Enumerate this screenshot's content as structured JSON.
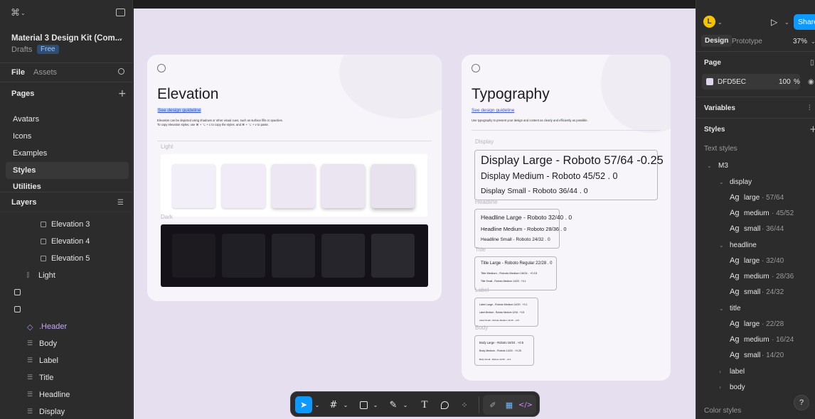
{
  "left_panel": {
    "file_title": "Material 3 Design Kit (Com...",
    "drafts": "Drafts",
    "plan_badge": "Free",
    "tab_file": "File",
    "tab_assets": "Assets",
    "pages_header": "Pages",
    "pages": [
      "Avatars",
      "Icons",
      "Examples",
      "Styles",
      "Utilities"
    ],
    "layers_header": "Layers",
    "layers": {
      "elevation3": "Elevation 3",
      "elevation4": "Elevation 4",
      "elevation5": "Elevation 5",
      "light": "Light",
      "header": ".Header",
      "body": "Body",
      "label": "Label",
      "title": "Title",
      "headline": "Headline",
      "display": "Display"
    }
  },
  "elevation_frame": {
    "title": "Elevation",
    "link": "See design guideline",
    "desc_line1": "Elevation can be depicted using shadows or other visual cues, such as surface fills or opacities.",
    "desc_line2": "To copy elevation styles, use ⌘ + ⌥ + c to copy the styles. and ⌘ + ⌥ + v to paste.",
    "light_label": "Light",
    "dark_label": "Dark"
  },
  "typography_frame": {
    "title": "Typography",
    "link": "See design guideline",
    "desc": "Use typography to present your design and content as clearly and efficiently as possible.",
    "display_label": "Display",
    "display_large": "Display Large - Roboto 57/64 -0.25",
    "display_medium": "Display Medium - Roboto 45/52 .  0",
    "display_small": "Display Small - Roboto 36/44 . 0",
    "headline_label": "Headline",
    "headline_large": "Headline Large - Roboto 32/40 . 0",
    "headline_medium": "Headline Medium - Roboto 28/36 . 0",
    "headline_small": "Headline Small - Roboto 24/32 . 0",
    "title_label": "Title",
    "title_large": "Title Large - Roboto Regular 22/28 . 0",
    "title_medium": "Title Medium - Roboto Medium 16/24 . +0.15",
    "title_small": "Title Small - Roboto Medium 14/20 . +0.1",
    "label_label": "Label",
    "label_large": "Label Large - Roboto Medium 14/20 . +0.1",
    "label_medium": "Label Medium - Roboto Medium 12/16 . +0.5",
    "label_small": "Label Small - Roboto Medium 11/16 . +0.5",
    "body_label": "Body",
    "body_large": "Body Large - Roboto 16/24 . +0.5",
    "body_medium": "Body Medium - Roboto 14/20 . +0.25",
    "body_small": "Body Small - Roboto 12/16 . +0.4"
  },
  "right_panel": {
    "avatar_letter": "L",
    "share": "Share",
    "tab_design": "Design",
    "tab_prototype": "Prototype",
    "zoom": "37%",
    "page_header": "Page",
    "page_color": "DFD5EC",
    "page_opacity": "100",
    "percent": "%",
    "variables": "Variables",
    "styles": "Styles",
    "text_styles": "Text styles",
    "group_m3": "M3",
    "display_group": "display",
    "headline_group": "headline",
    "title_group": "title",
    "label_group": "label",
    "body_group": "body",
    "ag": "Ag",
    "display_items": [
      {
        "name": "large",
        "spec": "· 57/64"
      },
      {
        "name": "medium",
        "spec": "· 45/52"
      },
      {
        "name": "small",
        "spec": "· 36/44"
      }
    ],
    "headline_items": [
      {
        "name": "large",
        "spec": "· 32/40"
      },
      {
        "name": "medium",
        "spec": "· 28/36"
      },
      {
        "name": "small",
        "spec": "· 24/32"
      }
    ],
    "title_items": [
      {
        "name": "large",
        "spec": "· 22/28"
      },
      {
        "name": "medium",
        "spec": "· 16/24"
      },
      {
        "name": "small",
        "spec": "· 14/20"
      }
    ],
    "color_styles": "Color styles",
    "help": "?"
  },
  "toolbar": {
    "text_tool": "T"
  },
  "colors": {
    "canvas": "#e5dff0",
    "accent": "#0d99ff",
    "avatar": "#f5c400",
    "page_swatch": "#dfd5ec",
    "frame_bg": "#f7f5f9",
    "dark_panel": "#141218"
  }
}
